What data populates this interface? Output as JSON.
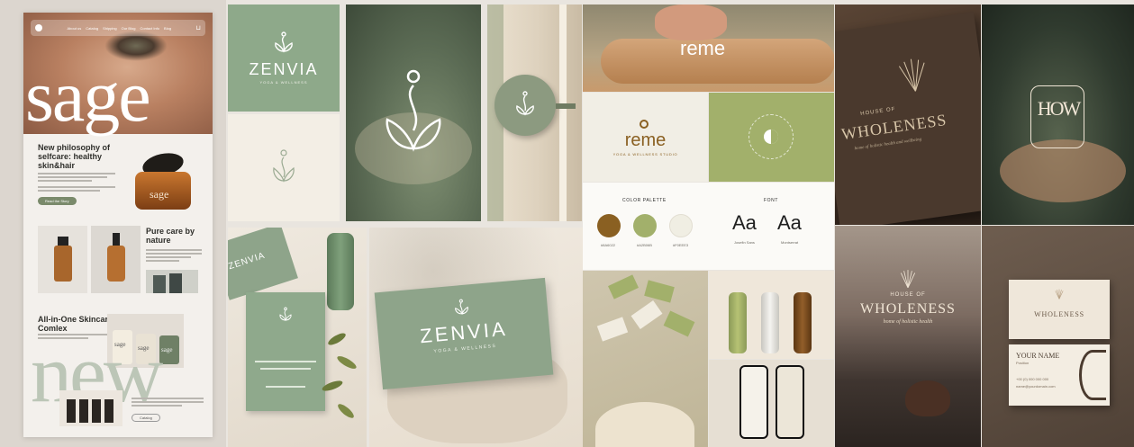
{
  "sage_site": {
    "nav_links": [
      "About us",
      "Catalog",
      "Shipping",
      "Our Blog",
      "Contact Info",
      "Blog"
    ],
    "brand_word": "sage",
    "section1_title": "New philosophy of selfcare: healthy skin&hair",
    "section1_button": "Read the Story",
    "jar_label": "sage",
    "section2_title": "Pure care by nature",
    "section3_title": "All-in-One Skincare Comlex",
    "product_labels": [
      "sage",
      "sage",
      "sage"
    ],
    "big_word": "new",
    "section3_button": "Catalog"
  },
  "zenvia": {
    "logo_word": "ZENVIA",
    "tagline": "YOGA & WELLNESS",
    "card_word": "ZENVIA",
    "card_tagline": "YOGA & WELLNESS",
    "cup_word": "ZENVIA"
  },
  "reme": {
    "mat_word": "reme",
    "logo_word": "reme",
    "logo_tagline": "YOGA & WELLNESS STUDIO",
    "palette_title": "COLOR PALETTE",
    "font_title": "FONT",
    "swatches": [
      {
        "name": "#8A6022",
        "color": "#8a6022"
      },
      {
        "name": "#A2B06B",
        "color": "#a2b06b"
      },
      {
        "name": "#F0EEE3",
        "color": "#f0eee3"
      }
    ],
    "fonts": [
      {
        "sample": "Aa",
        "name": "Josefin Sans"
      },
      {
        "sample": "Aa",
        "name": "Montserrat"
      }
    ]
  },
  "wholeness": {
    "card_line1": "HOUSE OF",
    "card_line2": "WHOLENESS",
    "card_sub": "home of holistic health and wellbeing",
    "monogram": "HOW",
    "poster_line1": "HOUSE OF",
    "poster_line2": "WHOLENESS",
    "poster_sub": "home of holistic health",
    "bc_line1": "WHOLENESS",
    "bc_name": "YOUR NAME",
    "bc_title": "Position",
    "bc_phone": "+00 (0) 000 000 000",
    "bc_email": "name@yourdomain.com"
  },
  "colors": {
    "sage_green": "#7a8a6b",
    "zenvia_green": "#8ea98a",
    "zenvia_cream": "#f3eee5",
    "reme_green": "#a2b06b",
    "wholeness_brown": "#3b2b21"
  }
}
